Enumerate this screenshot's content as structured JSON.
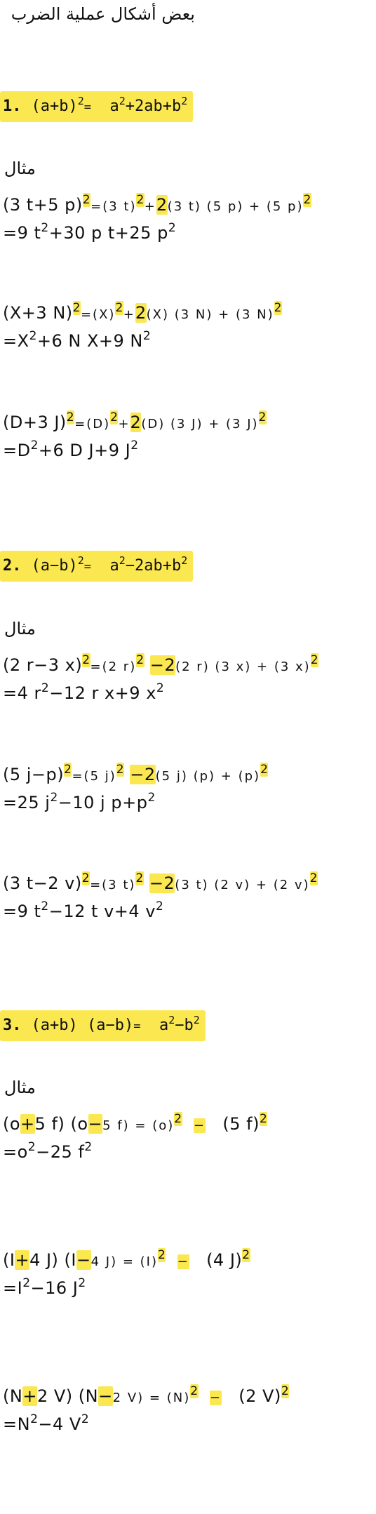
{
  "title": "بعض أشكال عملية الضرب",
  "example_label": "مثال",
  "sections": [
    {
      "formula": {
        "num": "1.",
        "lhs": "(a+b)",
        "sup_lhs": "2",
        "eq": "=",
        "rhs_a": "a",
        "sup_a": "2",
        "mid": "+2ab+b",
        "sup_b": "2"
      },
      "examples": [
        {
          "l1": [
            "(3 t+5 p)",
            "2",
            "=(3 t)",
            "2",
            "+",
            "2",
            "(3 t) (5 p) + (5 p)",
            "2"
          ],
          "l2": [
            "=9 t",
            "2",
            "+30 p t+25 p",
            "2"
          ]
        },
        {
          "l1": [
            "(X+3 N)",
            "2",
            "=(X)",
            "2",
            "+",
            "2",
            "(X) (3 N) + (3 N)",
            "2"
          ],
          "l2": [
            "=X",
            "2",
            "+6 N X+9 N",
            "2"
          ]
        },
        {
          "l1": [
            "(D+3 J)",
            "2",
            "=(D)",
            "2",
            "+",
            "2",
            "(D) (3 J) + (3 J)",
            "2"
          ],
          "l2": [
            "=D",
            "2",
            "+6 D J+9 J",
            "2"
          ]
        }
      ]
    },
    {
      "formula": {
        "num": "2.",
        "lhs": "(a−b)",
        "sup_lhs": "2",
        "eq": "=",
        "rhs_a": "a",
        "sup_a": "2",
        "mid": "−2ab+b",
        "sup_b": "2"
      },
      "examples": [
        {
          "l1": [
            "(2 r−3 x)",
            "2",
            "=(2 r)",
            "2",
            "−2",
            "(2 r) (3 x) + (3 x)",
            "2"
          ],
          "l2": [
            "=4 r",
            "2",
            "−12 r x+9 x",
            "2"
          ]
        },
        {
          "l1": [
            "(5 j−p)",
            "2",
            "=(5 j)",
            "2",
            "−2",
            "(5 j) (p) + (p)",
            "2"
          ],
          "l2": [
            "=25 j",
            "2",
            "−10 j p+p",
            "2"
          ]
        },
        {
          "l1": [
            "(3 t−2 v)",
            "2",
            "=(3 t)",
            "2",
            "−2",
            "(3 t) (2 v) + (2 v)",
            "2"
          ],
          "l2": [
            "=9 t",
            "2",
            "−12 t v+4 v",
            "2"
          ]
        }
      ]
    },
    {
      "formula": {
        "num": "3.",
        "lhs": "(a+b) (a−b)",
        "eq": "=",
        "rhs_a": "a",
        "sup_a": "2",
        "mid": "−b",
        "sup_b": "2"
      },
      "examples": [
        {
          "l1": [
            "(o",
            "+",
            "5 f) (o",
            "−",
            "5 f) = (o)",
            "2",
            "−",
            "(5 f)",
            "2"
          ],
          "l2": [
            "=o",
            "2",
            "−25 f",
            "2"
          ]
        },
        {
          "l1": [
            "(I",
            "+",
            "4 J) (I",
            "−",
            "4 J) = (I)",
            "2",
            "−",
            "(4 J)",
            "2"
          ],
          "l2": [
            "=I",
            "2",
            "−16 J",
            "2"
          ]
        },
        {
          "l1": [
            "(N",
            "+",
            "2 V) (N",
            "−",
            "2 V) = (N)",
            "2",
            "−",
            "(2 V)",
            "2"
          ],
          "l2": [
            "=N",
            "2",
            "−4 V",
            "2"
          ]
        }
      ]
    }
  ]
}
